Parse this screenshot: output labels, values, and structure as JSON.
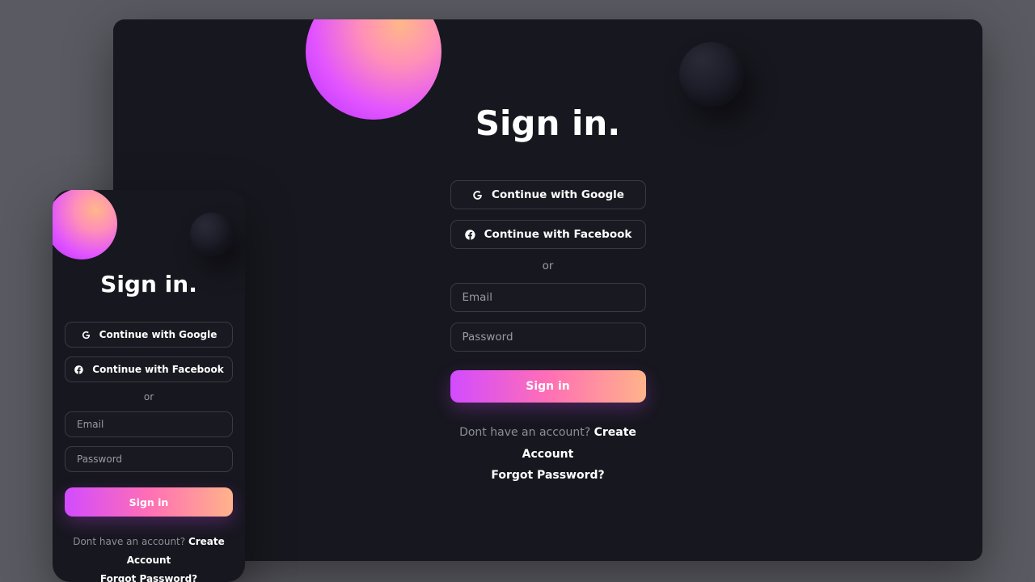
{
  "heading": "Sign in.",
  "google_label": "Continue with Google",
  "facebook_label": "Continue with Facebook",
  "or": "or",
  "email_placeholder": "Email",
  "password_placeholder": "Password",
  "submit_label": "Sign in",
  "prompt_text": "Dont have an account? ",
  "create_label": "Create Account",
  "forgot_label": "Forgot Password?"
}
